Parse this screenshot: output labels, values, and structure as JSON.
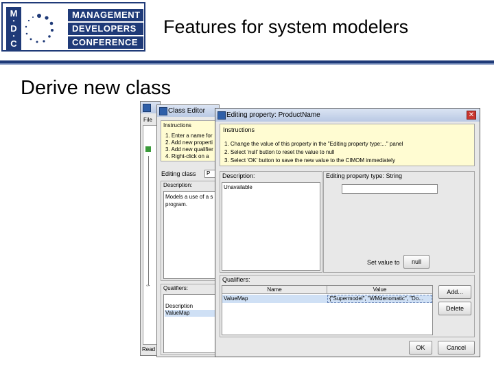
{
  "header": {
    "logo_letters": [
      "M",
      "D",
      "C"
    ],
    "logo_lines": [
      "MANAGEMENT",
      "DEVELOPERS",
      "CONFERENCE"
    ],
    "title": "Features for system modelers"
  },
  "subtitle": "Derive new class",
  "back_window": {
    "menu_label": "File"
  },
  "class_editor": {
    "title": "Class Editor",
    "instructions_label": "Instructions",
    "instructions": [
      "1. Enter a name for",
      "2. Add new properti",
      "3. Add new qualifier",
      "4. Right-click on a"
    ],
    "editing_class_label": "Editing class",
    "editing_class_value": "P",
    "description_label": "Description:",
    "description_text": "Models a use of a s program.",
    "qualifiers_label": "Qualifiers:",
    "qualifier_items": [
      "Description",
      "ValueMap"
    ]
  },
  "property_dialog": {
    "title_prefix": "Editing property:",
    "title_name": "ProductName",
    "instructions_label": "Instructions",
    "instructions": [
      "1. Change the value of this property in the \"Editing property type:...\" panel",
      "2. Select 'null' button to reset the value to null",
      "3. Select 'OK' button to save the new value to the CIMOM immediately"
    ],
    "description_label": "Description:",
    "description_value": "Unavailable",
    "property_type_label": "Editing property type: String",
    "value_input": "",
    "set_value_label": "Set value to",
    "null_button": "null",
    "qualifiers_label": "Qualifiers:",
    "table_headers": [
      "Name",
      "Value"
    ],
    "table_rows": [
      {
        "name": "ValueMap",
        "value": "{\"Supermodel\", \"WMdenomatic\", \"Do..."
      }
    ],
    "add_button": "Add...",
    "delete_button": "Delete",
    "ok_button": "OK",
    "cancel_button": "Cancel"
  },
  "status": {
    "ready_text": "Read"
  },
  "colors": {
    "brand_navy": "#1f3a78",
    "close_red": "#c8352e",
    "selection_blue": "#cfe0f5",
    "instructions_yellow": "#fffcd2"
  }
}
